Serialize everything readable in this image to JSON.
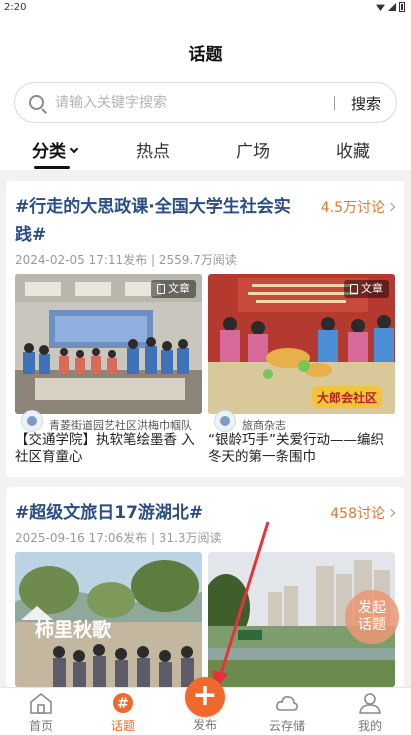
{
  "status_bar": {
    "time": "2:20"
  },
  "header": {
    "title": "话题"
  },
  "search": {
    "placeholder": "请输入关键字搜索",
    "button_label": "搜索"
  },
  "tabs": [
    {
      "label": "分类",
      "active": true
    },
    {
      "label": "热点"
    },
    {
      "label": "广场"
    },
    {
      "label": "收藏"
    }
  ],
  "topics": [
    {
      "title": "#行走的大思政课·全国大学生社会实践#",
      "discussions": "4.5万讨论",
      "meta": "2024-02-05 17:11发布 | 2559.7万阅读",
      "posts": [
        {
          "source": "青菱街道园艺社区洪梅巾帼队",
          "badge": "文章",
          "title": "【交通学院】执软笔绘墨香 入社区育童心"
        },
        {
          "source": "旅商杂志",
          "badge": "文章",
          "title": "“银龄巧手”关爱行动——编织冬天的第一条围巾"
        }
      ]
    },
    {
      "title": "#超级文旅日17游湖北#",
      "discussions": "458讨论",
      "meta": "2025-09-16 17:06发布 | 31.3万阅读",
      "posts": [
        {
          "image_text": "柿里秋歌"
        },
        {}
      ]
    }
  ],
  "float_button": {
    "line1": "发起",
    "line2": "话题"
  },
  "nav": [
    {
      "label": "首页",
      "icon": "home-icon"
    },
    {
      "label": "话题",
      "icon": "hashtag-icon",
      "active": true
    },
    {
      "label": "发布",
      "icon": "plus-icon"
    },
    {
      "label": "云存储",
      "icon": "cloud-icon"
    },
    {
      "label": "我的",
      "icon": "user-icon"
    }
  ],
  "colors": {
    "accent": "#ee6a2c",
    "topic_title": "#2a4e82",
    "discussion_count": "#e0762f",
    "annotation_arrow": "#e8323a"
  }
}
